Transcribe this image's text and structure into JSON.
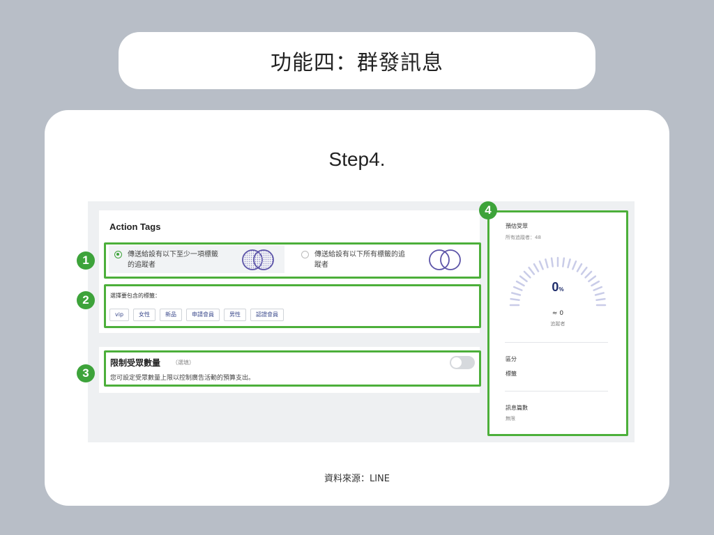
{
  "header": {
    "title": "功能四：群發訊息"
  },
  "step_label": "Step4.",
  "form": {
    "section_title": "Action Tags",
    "options": [
      {
        "label_line1": "傳送給設有以下至少一項標籤",
        "label_line2": "的追蹤者",
        "selected": true
      },
      {
        "label_line1": "傳送給設有以下所有標籤的追",
        "label_line2": "蹤者",
        "selected": false
      }
    ],
    "tag_prompt": "選擇要包含的標籤：",
    "tags": [
      "vip",
      "女性",
      "新品",
      "申請會員",
      "男性",
      "認證會員"
    ],
    "limit": {
      "title": "限制受眾數量",
      "optional": "（選填）",
      "description": "您可設定受眾數量上限以控制廣告活動的預算支出。",
      "toggle_on": false
    }
  },
  "sidebar": {
    "title": "預估受眾",
    "followers": "所有追蹤者：48",
    "percent": "0",
    "percent_unit": "%",
    "percent_value": 0,
    "approx": "≈ 0",
    "approx_label": "追蹤者",
    "segment_label": "區分",
    "segment_value": "標籤",
    "message_label": "訊息篇數",
    "message_value": "無限"
  },
  "annotations": [
    "1",
    "2",
    "3",
    "4"
  ],
  "footer": {
    "source": "資料來源：LINE"
  },
  "colors": {
    "highlight": "#4caf3a",
    "badge": "#3da33a",
    "gauge_tick": "#c9cce8",
    "accent_text": "#1f2d6b"
  }
}
